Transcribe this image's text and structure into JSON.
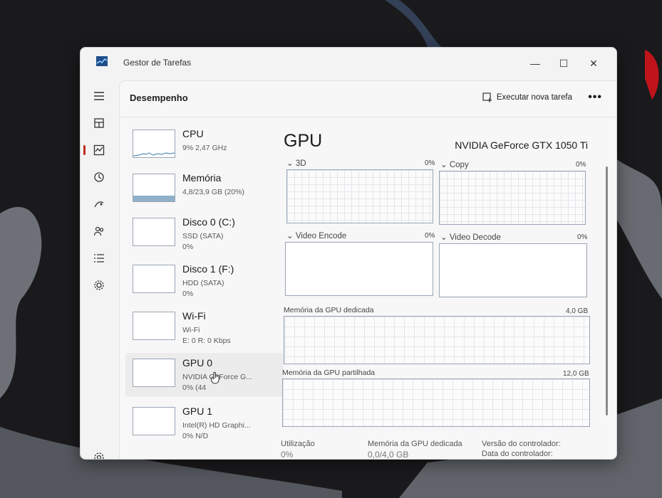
{
  "window": {
    "title": "Gestor de Tarefas",
    "minimize": "—",
    "maximize": "☐",
    "close": "✕"
  },
  "page": {
    "title": "Desempenho",
    "run_task_label": "Executar nova tarefa",
    "more_label": "•••"
  },
  "rail": {
    "icons": [
      "hamburger-menu-icon",
      "processes-icon",
      "performance-icon",
      "app-history-icon",
      "startup-apps-icon",
      "users-icon",
      "details-icon",
      "services-icon",
      "settings-icon"
    ],
    "active": "performance-icon"
  },
  "devices": [
    {
      "name": "CPU",
      "line1": "9% 2,47 GHz",
      "line2": "",
      "usage": 0.09
    },
    {
      "name": "Memória",
      "line1": "4,8/23,9 GB (20%)",
      "line2": "",
      "usage": 0.2
    },
    {
      "name": "Disco 0 (C:)",
      "line1": "SSD (SATA)",
      "line2": "0%",
      "usage": 0
    },
    {
      "name": "Disco 1 (F:)",
      "line1": "HDD (SATA)",
      "line2": "0%",
      "usage": 0
    },
    {
      "name": "Wi-Fi",
      "line1": "Wi-Fi",
      "line2": "E: 0 R: 0 Kbps",
      "usage": 0
    },
    {
      "name": "GPU 0",
      "line1": "NVIDIA GeForce G...",
      "line2": "0% (44",
      "usage": 0
    },
    {
      "name": "GPU 1",
      "line1": "Intel(R) HD Graphi...",
      "line2": "0% N/D",
      "usage": 0
    }
  ],
  "selected_device": "GPU 0",
  "detail": {
    "title": "GPU",
    "model": "NVIDIA GeForce GTX 1050 Ti",
    "engines": [
      {
        "label": "3D",
        "pct": "0%"
      },
      {
        "label": "Copy",
        "pct": "0%"
      },
      {
        "label": "Video Encode",
        "pct": "0%"
      },
      {
        "label": "Video Decode",
        "pct": "0%"
      }
    ],
    "dedicated_memory": {
      "label": "Memória da GPU dedicada",
      "max": "4,0 GB"
    },
    "shared_memory": {
      "label": "Memória da GPU partilhada",
      "max": "12,0 GB"
    },
    "stats": {
      "utilization_label": "Utilização",
      "dedicated_label": "Memória da GPU dedicada",
      "driver_version_label": "Versão do controlador:",
      "driver_date_label": "Data do controlador:",
      "utilization_value": "0%",
      "dedicated_value": "0,0/4,0 GB"
    }
  },
  "colors": {
    "accent": "#c42b1c",
    "graph_border": "#9aa5b5",
    "cpu_line": "#5a93b8",
    "mem_fill": "#8fb0c8",
    "background": "#1c1c1e"
  }
}
